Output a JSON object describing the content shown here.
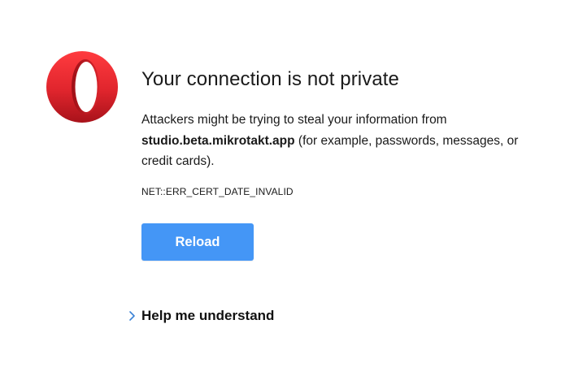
{
  "page": {
    "title": "Your connection is not private",
    "message_prefix": "Attackers might be trying to steal your information from ",
    "domain": "studio.beta.mikrotakt.app",
    "message_suffix": " (for example, passwords, messages, or credit cards).",
    "error_code": "NET::ERR_CERT_DATE_INVALID"
  },
  "actions": {
    "reload_label": "Reload",
    "help_label": "Help me understand"
  },
  "icons": {
    "logo": "opera-logo-icon",
    "help_chevron": "chevron-right-icon"
  },
  "colors": {
    "logo_red": "#e0252d",
    "button_blue": "#4496f6",
    "chevron_blue": "#3b82d6"
  }
}
